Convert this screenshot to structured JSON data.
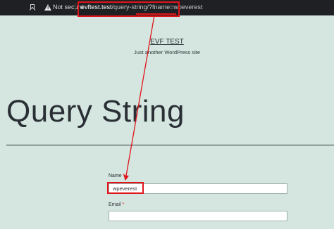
{
  "browser": {
    "security_label": "Not secure",
    "url_host": "evftest.test",
    "url_path": "/query-string/?fname=wpeverest"
  },
  "site": {
    "title": "EVF TEST",
    "tagline": "Just another WordPress site"
  },
  "page": {
    "title": "Query String"
  },
  "form": {
    "name_label": "Name",
    "name_value": "wpeverest",
    "email_label": "Email",
    "email_value": "",
    "required_marker": "*"
  },
  "colors": {
    "annotation": "#e0141a",
    "page_background": "#d4e6df",
    "browser_bar": "#1f2023"
  }
}
